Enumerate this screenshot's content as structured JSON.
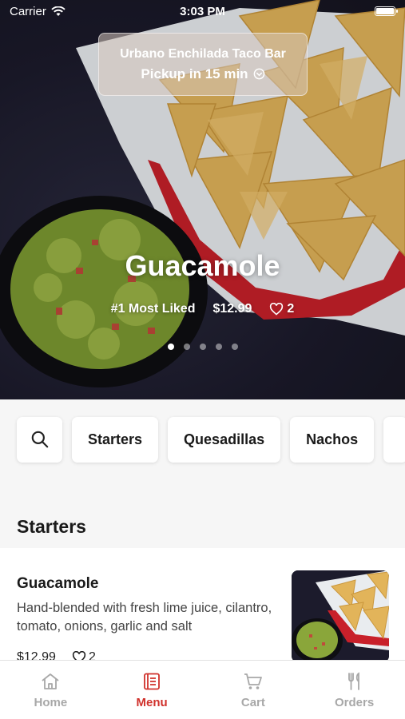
{
  "status_bar": {
    "carrier": "Carrier",
    "time": "3:03 PM"
  },
  "store": {
    "name": "Urbano Enchilada Taco Bar",
    "pickup": "Pickup in 15 min"
  },
  "hero": {
    "title": "Guacamole",
    "badge": "#1 Most Liked",
    "price": "$12.99",
    "likes": "2",
    "slides": 5,
    "active_slide": 1
  },
  "categories": {
    "search_icon": "search-icon",
    "items": [
      "Starters",
      "Quesadillas",
      "Nachos"
    ]
  },
  "section": {
    "title": "Starters"
  },
  "menu_item": {
    "name": "Guacamole",
    "description": "Hand-blended with fresh lime juice, cilantro, tomato, onions, garlic and salt",
    "price": "$12.99",
    "likes": "2"
  },
  "tabbar": {
    "tabs": [
      {
        "label": "Home",
        "icon": "home-icon"
      },
      {
        "label": "Menu",
        "icon": "menu-icon"
      },
      {
        "label": "Cart",
        "icon": "cart-icon"
      },
      {
        "label": "Orders",
        "icon": "utensils-icon"
      }
    ],
    "active": "Menu"
  },
  "colors": {
    "accent": "#d0312b",
    "inactive": "#a8a8a8"
  }
}
